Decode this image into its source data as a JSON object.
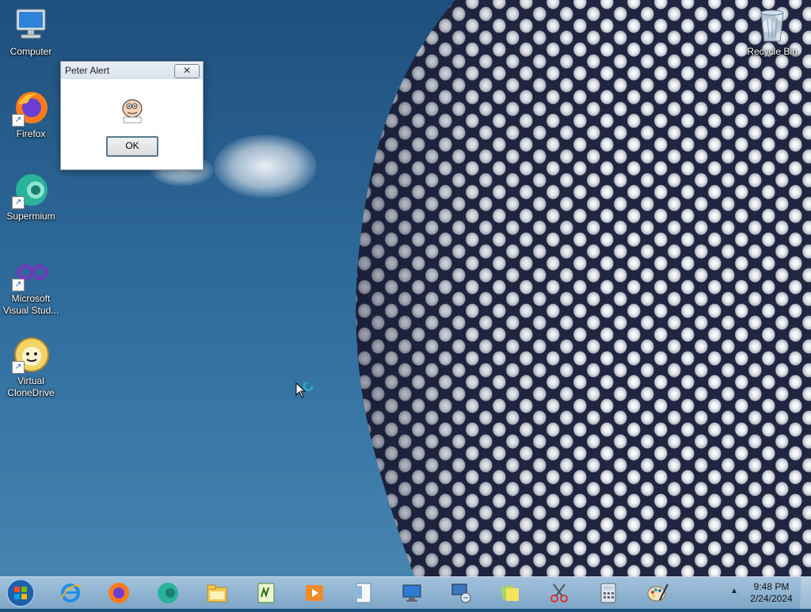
{
  "desktop": {
    "icons": [
      {
        "label": "Computer",
        "icon": "computer-icon"
      },
      {
        "label": "Firefox",
        "icon": "firefox-icon"
      },
      {
        "label": "Supermium",
        "icon": "supermium-icon"
      },
      {
        "label": "Microsoft Visual Stud...",
        "icon": "visual-studio-icon"
      },
      {
        "label": "Virtual CloneDrive",
        "icon": "virtual-clonedrive-icon"
      },
      {
        "label": "Recycle Bin",
        "icon": "recycle-bin-icon"
      }
    ]
  },
  "dialog": {
    "title": "Peter Alert",
    "close_label": "✕",
    "ok_label": "OK",
    "image": "peter-face-icon"
  },
  "taskbar": {
    "start": "windows-start-icon",
    "pinned": [
      "internet-explorer-icon",
      "firefox-icon",
      "supermium-icon",
      "file-explorer-icon",
      "notepad-plus-plus-icon",
      "media-player-icon",
      "document-viewer-icon",
      "remote-desktop-icon",
      "network-computer-icon",
      "sticky-notes-icon",
      "snipping-tool-icon",
      "calculator-icon",
      "paint-icon"
    ],
    "tray_arrow": "▲",
    "time": "9:48 PM",
    "date": "2/24/2024"
  },
  "colors": {
    "sky": "#2c6797",
    "taskbar": "#a9c6de",
    "dialog_bg": "#ffffff",
    "accent": "#3c7fb1"
  }
}
